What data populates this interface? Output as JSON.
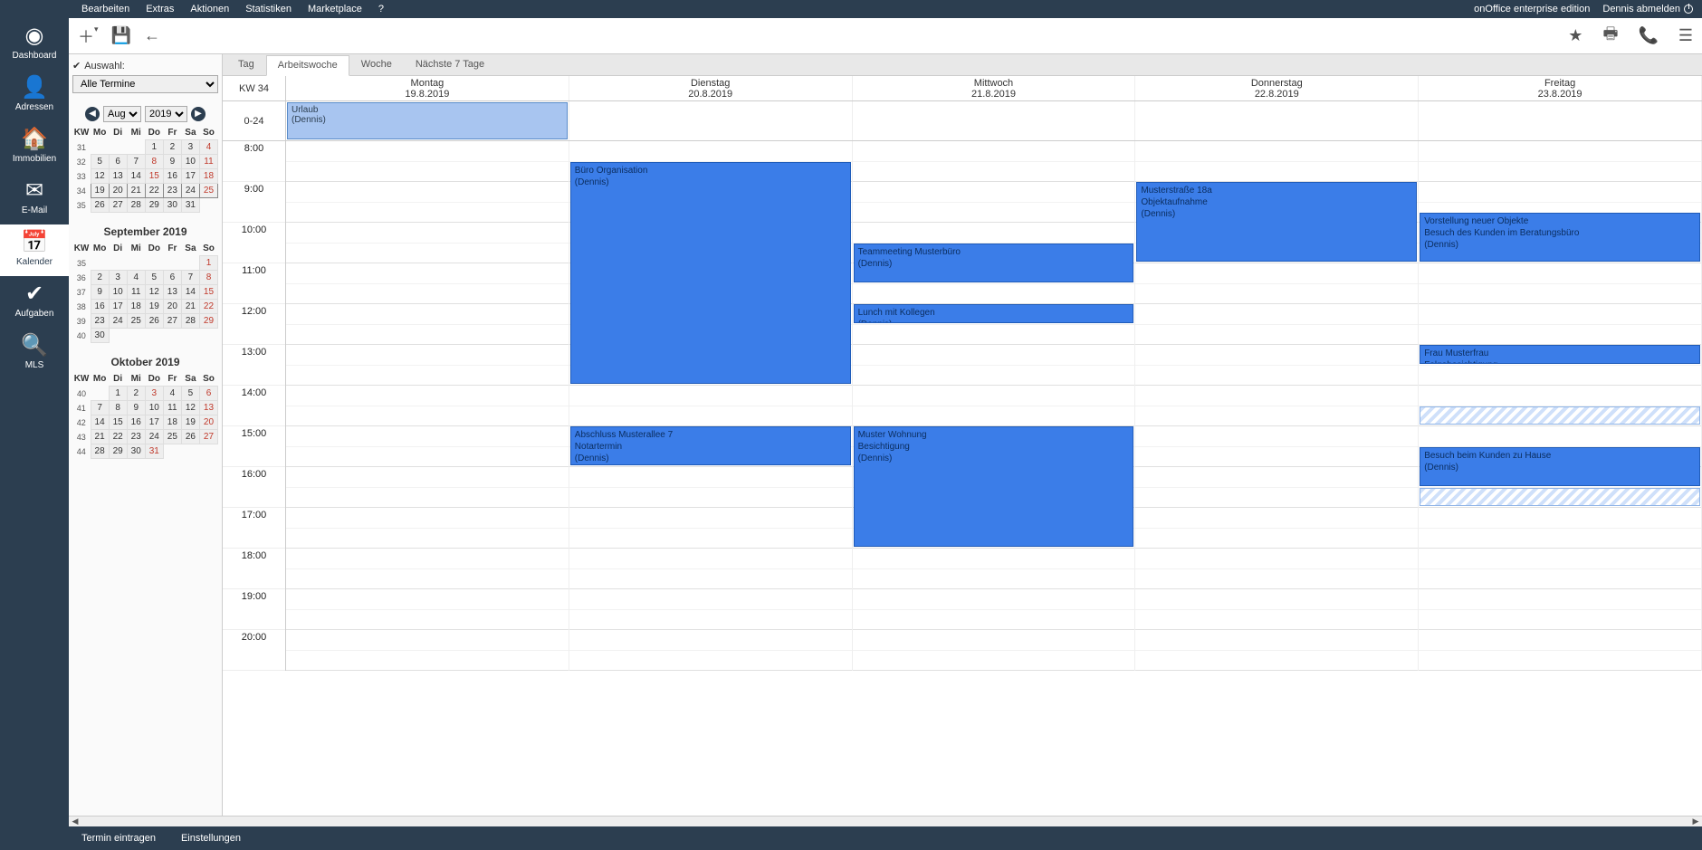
{
  "topmenu": {
    "items": [
      "Bearbeiten",
      "Extras",
      "Aktionen",
      "Statistiken",
      "Marketplace",
      "?"
    ],
    "edition": "onOffice enterprise edition",
    "logout": "Dennis abmelden"
  },
  "leftnav": {
    "items": [
      {
        "label": "Dashboard",
        "icon": "◉"
      },
      {
        "label": "Adressen",
        "icon": "👤"
      },
      {
        "label": "Immobilien",
        "icon": "🏠"
      },
      {
        "label": "E-Mail",
        "icon": "✉"
      },
      {
        "label": "Kalender",
        "icon": "📅",
        "active": true
      },
      {
        "label": "Aufgaben",
        "icon": "✔"
      },
      {
        "label": "MLS",
        "icon": "🔍"
      }
    ]
  },
  "sidebar": {
    "auswahl_label": "Auswahl:",
    "filter_value": "Alle Termine",
    "month_select": "Aug",
    "year_select": "2019",
    "weekday_header": [
      "KW",
      "Mo",
      "Di",
      "Mi",
      "Do",
      "Fr",
      "Sa",
      "So"
    ],
    "cal_aug": {
      "rows": [
        {
          "kw": "31",
          "days": [
            "",
            "",
            "",
            "1",
            "2",
            "3",
            "4"
          ]
        },
        {
          "kw": "32",
          "days": [
            "5",
            "6",
            "7",
            "8",
            "9",
            "10",
            "11"
          ]
        },
        {
          "kw": "33",
          "days": [
            "12",
            "13",
            "14",
            "15",
            "16",
            "17",
            "18"
          ]
        },
        {
          "kw": "34",
          "days": [
            "19",
            "20",
            "21",
            "22",
            "23",
            "24",
            "25"
          ]
        },
        {
          "kw": "35",
          "days": [
            "26",
            "27",
            "28",
            "29",
            "30",
            "31",
            ""
          ]
        }
      ]
    },
    "cal_sep": {
      "caption": "September 2019",
      "rows": [
        {
          "kw": "35",
          "days": [
            "",
            "",
            "",
            "",
            "",
            "",
            "1"
          ]
        },
        {
          "kw": "36",
          "days": [
            "2",
            "3",
            "4",
            "5",
            "6",
            "7",
            "8"
          ]
        },
        {
          "kw": "37",
          "days": [
            "9",
            "10",
            "11",
            "12",
            "13",
            "14",
            "15"
          ]
        },
        {
          "kw": "38",
          "days": [
            "16",
            "17",
            "18",
            "19",
            "20",
            "21",
            "22"
          ]
        },
        {
          "kw": "39",
          "days": [
            "23",
            "24",
            "25",
            "26",
            "27",
            "28",
            "29"
          ]
        },
        {
          "kw": "40",
          "days": [
            "30",
            "",
            "",
            "",
            "",
            "",
            ""
          ]
        }
      ]
    },
    "cal_oct": {
      "caption": "Oktober 2019",
      "rows": [
        {
          "kw": "40",
          "days": [
            "",
            "1",
            "2",
            "3",
            "4",
            "5",
            "6"
          ]
        },
        {
          "kw": "41",
          "days": [
            "7",
            "8",
            "9",
            "10",
            "11",
            "12",
            "13"
          ]
        },
        {
          "kw": "42",
          "days": [
            "14",
            "15",
            "16",
            "17",
            "18",
            "19",
            "20"
          ]
        },
        {
          "kw": "43",
          "days": [
            "21",
            "22",
            "23",
            "24",
            "25",
            "26",
            "27"
          ]
        },
        {
          "kw": "44",
          "days": [
            "28",
            "29",
            "30",
            "31",
            "",
            "",
            ""
          ]
        }
      ]
    }
  },
  "tabs": {
    "items": [
      "Tag",
      "Arbeitswoche",
      "Woche",
      "Nächste 7 Tage"
    ],
    "active": 1
  },
  "calendar": {
    "kw_label": "KW 34",
    "allday_label": "0-24",
    "days": [
      {
        "name": "Montag",
        "date": "19.8.2019"
      },
      {
        "name": "Dienstag",
        "date": "20.8.2019"
      },
      {
        "name": "Mittwoch",
        "date": "21.8.2019"
      },
      {
        "name": "Donnerstag",
        "date": "22.8.2019"
      },
      {
        "name": "Freitag",
        "date": "23.8.2019"
      }
    ],
    "time_slots": [
      "8:00",
      "9:00",
      "10:00",
      "11:00",
      "12:00",
      "13:00",
      "14:00",
      "15:00",
      "16:00",
      "17:00",
      "18:00",
      "19:00",
      "20:00"
    ],
    "allday_events": [
      {
        "day": 0,
        "title": "Urlaub",
        "who": "(Dennis)"
      }
    ],
    "events": [
      {
        "day": 1,
        "start": "8:30",
        "end": "14:00",
        "lines": [
          "Büro Organisation",
          "(Dennis)"
        ]
      },
      {
        "day": 1,
        "start": "15:00",
        "end": "16:00",
        "lines": [
          "Abschluss Musterallee 7",
          "Notartermin",
          "(Dennis)"
        ]
      },
      {
        "day": 2,
        "start": "10:30",
        "end": "11:30",
        "lines": [
          "Teammeeting Musterbüro",
          "(Dennis)"
        ]
      },
      {
        "day": 2,
        "start": "12:00",
        "end": "12:30",
        "lines": [
          "Lunch mit Kollegen",
          "(Dennis)"
        ]
      },
      {
        "day": 2,
        "start": "15:00",
        "end": "18:00",
        "lines": [
          "Muster Wohnung",
          "Besichtigung",
          "(Dennis)"
        ]
      },
      {
        "day": 3,
        "start": "9:00",
        "end": "11:00",
        "lines": [
          "Musterstraße 18a",
          "Objektaufnahme",
          "(Dennis)"
        ]
      },
      {
        "day": 4,
        "start": "9:45",
        "end": "11:00",
        "lines": [
          "Vorstellung neuer Objekte",
          "Besuch des Kunden im Beratungsbüro",
          "(Dennis)"
        ]
      },
      {
        "day": 4,
        "start": "13:00",
        "end": "13:30",
        "lines": [
          "Frau Musterfrau",
          "Folgebesichtigung"
        ]
      },
      {
        "day": 4,
        "start": "14:30",
        "end": "15:00",
        "lines": [
          ""
        ],
        "striped": true
      },
      {
        "day": 4,
        "start": "15:30",
        "end": "16:30",
        "lines": [
          "Besuch beim Kunden zu Hause",
          "(Dennis)"
        ]
      },
      {
        "day": 4,
        "start": "16:30",
        "end": "17:00",
        "lines": [
          ""
        ],
        "striped": true
      }
    ]
  },
  "bottombar": {
    "items": [
      "Termin eintragen",
      "Einstellungen"
    ]
  }
}
